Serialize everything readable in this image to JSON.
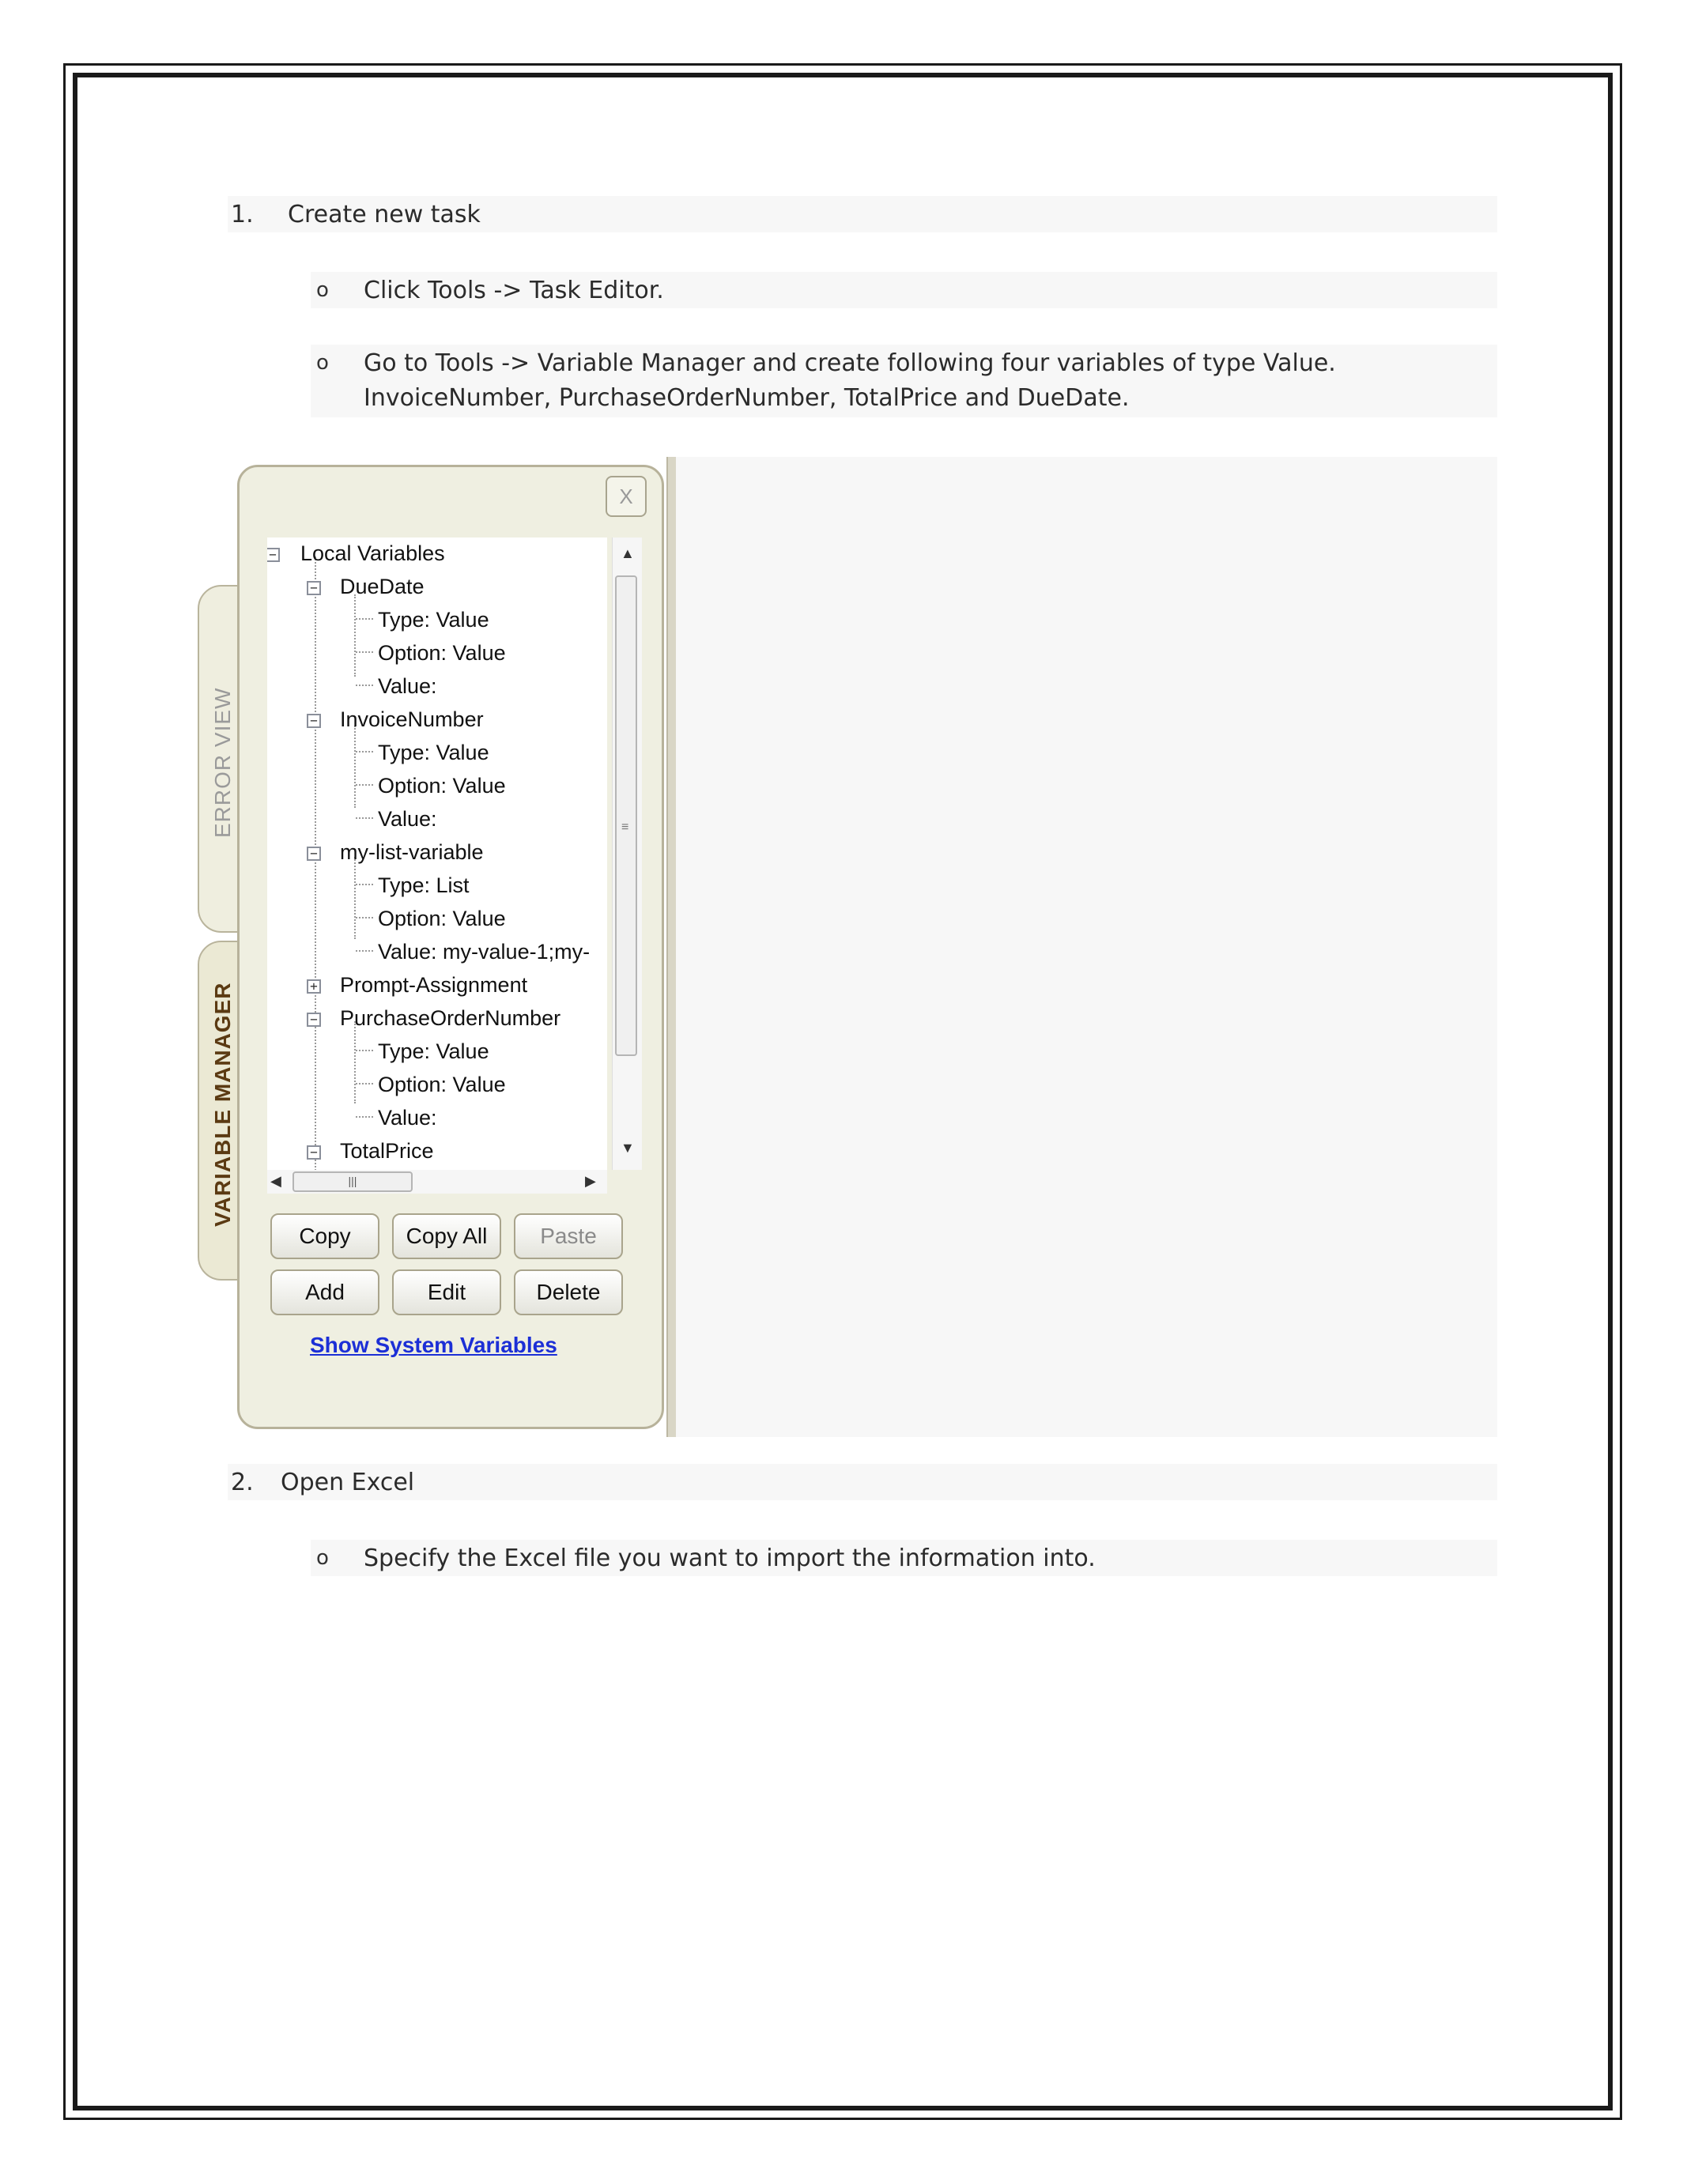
{
  "steps": [
    {
      "number": "1.",
      "title": "Create new task"
    },
    {
      "number": "2.",
      "title": "Open Excel"
    }
  ],
  "step1_bullets": [
    "Click Tools -> Task Editor.",
    "Go to Tools -> Variable Manager and create following four variables of type Value.",
    "InvoiceNumber, PurchaseOrderNumber, TotalPrice and DueDate."
  ],
  "step2_bullets": [
    "Specify the Excel file you want to import the information into."
  ],
  "bullet_glyph": "o",
  "variable_manager": {
    "tabs": {
      "error_view": "ERROR VIEW",
      "variable_manager": "VARIABLE MANAGER"
    },
    "close_label": "X",
    "tree": {
      "root": "Local Variables",
      "groups": [
        {
          "name": "DueDate",
          "children": [
            "Type: Value",
            "Option: Value",
            "Value:"
          ]
        },
        {
          "name": "InvoiceNumber",
          "children": [
            "Type: Value",
            "Option: Value",
            "Value:"
          ]
        },
        {
          "name": "my-list-variable",
          "children": [
            "Type: List",
            "Option: Value",
            "Value: my-value-1;my-"
          ]
        },
        {
          "name": "Prompt-Assignment",
          "children": []
        },
        {
          "name": "PurchaseOrderNumber",
          "children": [
            "Type: Value",
            "Option: Value",
            "Value:"
          ]
        },
        {
          "name": "TotalPrice",
          "children": []
        }
      ]
    },
    "buttons": {
      "copy": "Copy",
      "copy_all": "Copy All",
      "paste": "Paste",
      "add": "Add",
      "edit": "Edit",
      "delete": "Delete"
    },
    "show_system_variables": "Show System Variables",
    "colors": {
      "panel": "#efefe1",
      "link": "#1c2fd6",
      "border": "#b7b29a"
    }
  }
}
